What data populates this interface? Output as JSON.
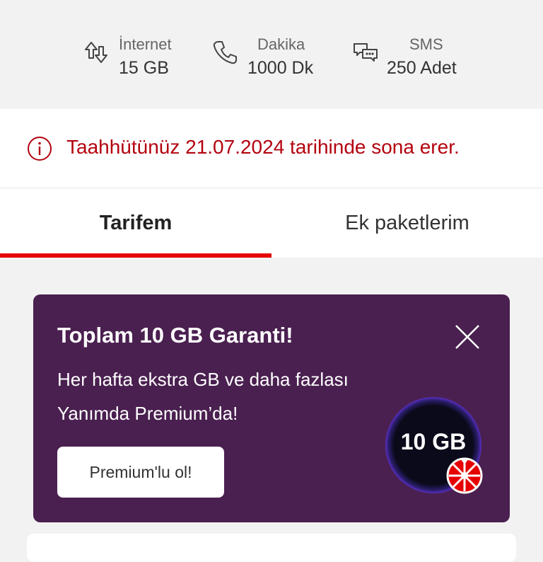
{
  "usage": {
    "internet": {
      "label": "İnternet",
      "value": "15 GB",
      "icon": "data-transfer-icon"
    },
    "dakika": {
      "label": "Dakika",
      "value": "1000 Dk",
      "icon": "phone-icon"
    },
    "sms": {
      "label": "SMS",
      "value": "250 Adet",
      "icon": "chat-bubbles-icon"
    }
  },
  "notice": {
    "text": "Taahhütünüz 21.07.2024 tarihinde sona erer.",
    "icon": "info-icon"
  },
  "tabs": [
    {
      "label": "Tarifem",
      "active": true
    },
    {
      "label": "Ek paketlerim",
      "active": false
    }
  ],
  "promo": {
    "title": "Toplam 10 GB Garanti!",
    "description": "Her hafta ekstra GB ve daha fazlası Yanımda Premium’da!",
    "cta_label": "Premium'lu ol!",
    "badge_text": "10 GB",
    "icons": [
      "close-icon",
      "wheel-icon"
    ]
  },
  "colors": {
    "brand_red": "#e60000",
    "notice_red": "#b4030f",
    "promo_purple": "#4a2050",
    "background": "#f2f2f2"
  }
}
